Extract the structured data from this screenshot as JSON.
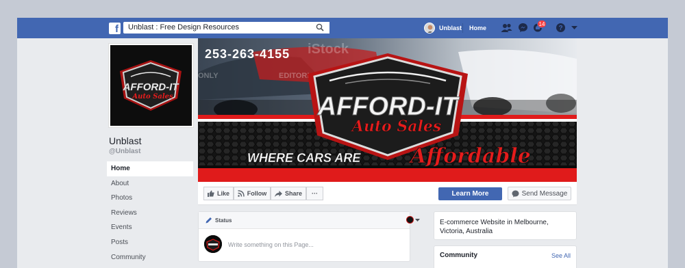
{
  "topbar": {
    "search_value": "Unblast : Free Design Resources",
    "profile_name": "Unblast",
    "home_label": "Home",
    "notification_count": "14"
  },
  "page": {
    "name": "Unblast",
    "handle": "@Unblast"
  },
  "sidebar": {
    "items": [
      {
        "label": "Home",
        "active": true
      },
      {
        "label": "About"
      },
      {
        "label": "Photos"
      },
      {
        "label": "Reviews"
      },
      {
        "label": "Events"
      },
      {
        "label": "Posts"
      },
      {
        "label": "Community"
      }
    ]
  },
  "cover": {
    "phone": "253-263-4155",
    "brand_line1": "AFFORD-IT",
    "brand_line2": "Auto Sales",
    "tagline": "WHERE CARS ARE",
    "tagline_script": "Affordable",
    "watermark1": "EDITORIAL",
    "watermark2": "ONLY",
    "watermark3": "iStock"
  },
  "logo": {
    "line1": "AFFORD-IT",
    "line2": "Auto Sales"
  },
  "actions": {
    "like": "Like",
    "follow": "Follow",
    "share": "Share",
    "more": "···",
    "learn_more": "Learn More",
    "send_message": "Send Message"
  },
  "status": {
    "label": "Status",
    "placeholder": "Write something on this Page..."
  },
  "about": {
    "text": "E-commerce Website in Melbourne, Victoria, Australia"
  },
  "community": {
    "title": "Community",
    "see_all": "See All"
  },
  "colors": {
    "fb_blue": "#4267b2",
    "accent_red": "#e01b1b"
  }
}
